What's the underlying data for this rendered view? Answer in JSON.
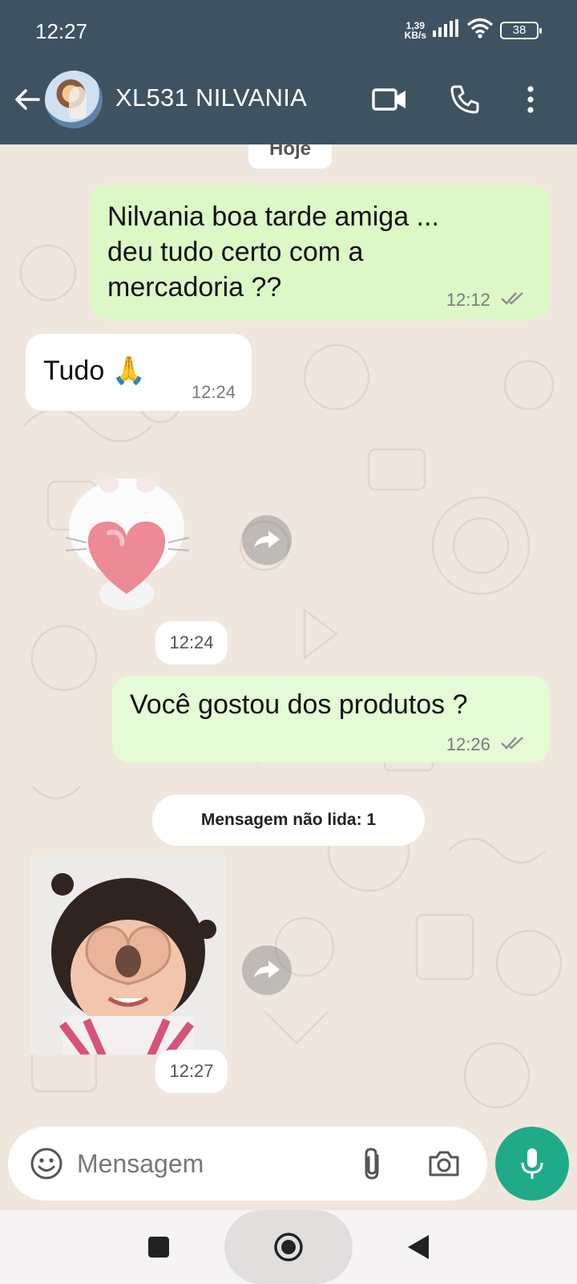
{
  "status": {
    "time": "12:27",
    "netspeed_value": "1,39",
    "netspeed_unit": "KB/s",
    "battery": "38"
  },
  "header": {
    "contact_name": "XL531 NILVANIA"
  },
  "chat": {
    "day_label": "Hoje",
    "messages": [
      {
        "dir": "out",
        "text_lines": [
          "Nilvania boa tarde amiga ...",
          "deu tudo certo com a",
          "mercadoria ??"
        ],
        "time": "12:12",
        "status": "read"
      },
      {
        "dir": "in",
        "text": "Tudo 🙏",
        "time": "12:24"
      },
      {
        "dir": "in",
        "kind": "sticker",
        "sticker": "white-cat-holding-heart",
        "time": "12:24"
      },
      {
        "dir": "out",
        "text": "Você gostou dos produtos ?",
        "time": "12:26",
        "status": "read"
      },
      {
        "dir": "in",
        "kind": "sticker",
        "sticker": "child-making-heart-hands",
        "time": "12:27"
      }
    ],
    "unread_label": "Mensagem não lida: 1"
  },
  "input": {
    "placeholder": "Mensagem"
  },
  "colors": {
    "header": "#3d5361",
    "outgoing": "#dcf8c6",
    "mic_button": "#1fab89",
    "ticks": "#8e8e8e"
  }
}
